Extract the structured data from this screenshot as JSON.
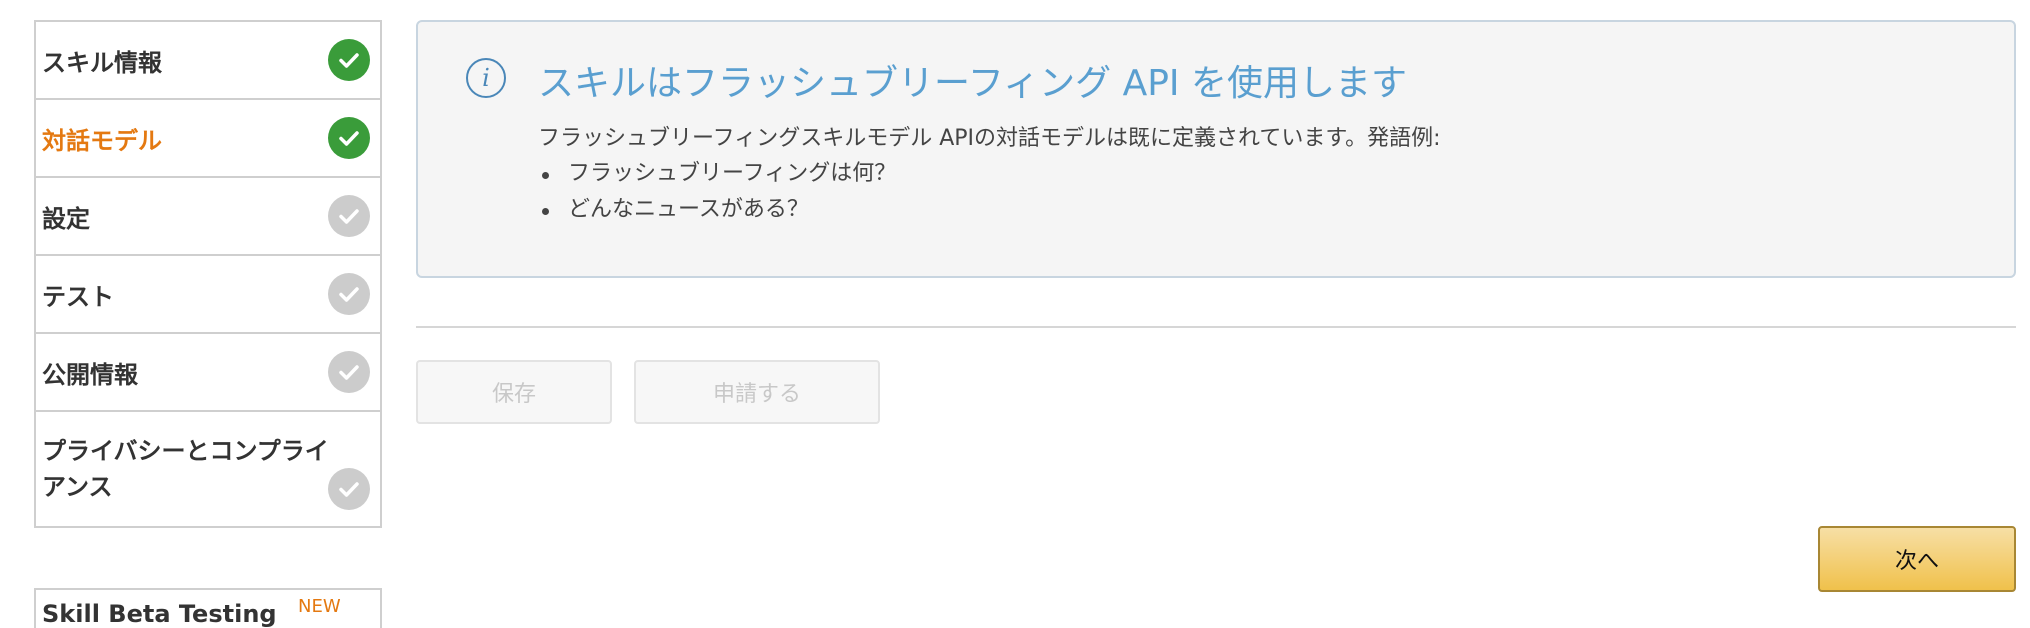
{
  "sidebar": {
    "steps": [
      {
        "label": "スキル情報",
        "status": "done"
      },
      {
        "label": "対話モデル",
        "status": "done",
        "active": true
      },
      {
        "label": "設定",
        "status": "todo"
      },
      {
        "label": "テスト",
        "status": "todo"
      },
      {
        "label": "公開情報",
        "status": "todo"
      },
      {
        "label": "プライバシーとコンプライアンス",
        "status": "todo"
      }
    ],
    "beta_section": {
      "label": "Skill Beta Testing",
      "badge": "NEW"
    }
  },
  "info_panel": {
    "icon": "info-icon",
    "icon_glyph": "i",
    "title": "スキルはフラッシュブリーフィング API を使用します",
    "description": "フラッシュブリーフィングスキルモデル APIの対話モデルは既に定義されています。発語例:",
    "examples": [
      "フラッシュブリーフィングは何？",
      "どんなニュースがある？"
    ]
  },
  "actions": {
    "save_label": "保存",
    "submit_label": "申請する",
    "next_label": "次へ"
  },
  "colors": {
    "active_step": "#e47911",
    "check_done": "#3a9c3a",
    "check_todo": "#cccccc",
    "info_title": "#5a9fd0",
    "next_button": "#f0c14b"
  }
}
